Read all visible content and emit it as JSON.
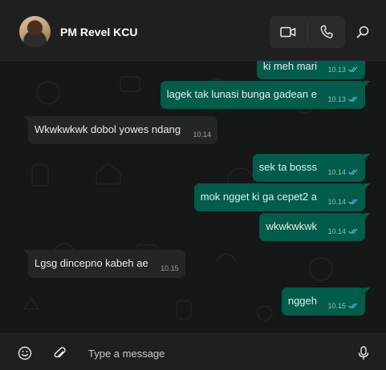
{
  "header": {
    "contact_name": "PM Revel KCU",
    "icons": [
      "video-call-icon",
      "voice-call-icon",
      "search-icon"
    ]
  },
  "colors": {
    "outgoing_bubble": "#005c4b",
    "incoming_bubble": "#242626",
    "read_tick": "#53bdeb",
    "background": "#161717"
  },
  "messages": [
    {
      "dir": "out",
      "text": "ki meh mari",
      "time": "10.13",
      "read": true
    },
    {
      "dir": "out",
      "text": "lagek tak lunasi bunga gadean e",
      "time": "10.13",
      "read": true
    },
    {
      "dir": "in",
      "text": "Wkwkwkwk dobol yowes ndang",
      "time": "10.14"
    },
    {
      "dir": "out",
      "text": "sek ta bosss",
      "time": "10.14",
      "read": true
    },
    {
      "dir": "out",
      "text": "mok ngget ki ga cepet2 a",
      "time": "10.14",
      "read": true
    },
    {
      "dir": "out",
      "text": "wkwkwkwk",
      "time": "10.14",
      "read": true
    },
    {
      "dir": "in",
      "text": "Lgsg dincepno kabeh ae",
      "time": "10.15"
    },
    {
      "dir": "out",
      "text": "nggeh",
      "time": "10.15",
      "read": true
    }
  ],
  "composer": {
    "placeholder": "Type a message",
    "icons": [
      "emoji-icon",
      "attach-icon",
      "microphone-icon"
    ]
  }
}
